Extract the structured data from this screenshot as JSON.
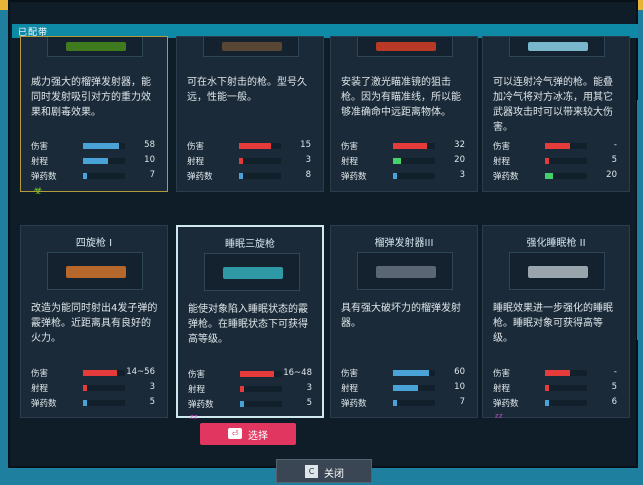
{
  "header": {
    "title": "已配带"
  },
  "stat_labels": {
    "damage": "伤害",
    "range": "射程",
    "ammo": "弹药数"
  },
  "colors": {
    "damage_bar": "#4aa3d6",
    "red_bar": "#e53b3b",
    "green_bar": "#44d36a",
    "select_button": "#e0365f"
  },
  "cards": [
    {
      "title": "",
      "description": "威力强大的榴弹发射器，能同时发射吸引对方的重力效果和剧毒效果。",
      "damage": "58",
      "range": "10",
      "ammo": "7",
      "damage_fill": 0.85,
      "range_fill": 0.6,
      "ammo_fill": 0.1,
      "status_icon": "biohazard-icon",
      "status_glyph": "☣"
    },
    {
      "title": "",
      "description": "可在水下射击的枪。型号久远，性能一般。",
      "damage": "15",
      "range": "3",
      "ammo": "8",
      "damage_fill": 0.75,
      "range_fill": 0.1,
      "ammo_fill": 0.1
    },
    {
      "title": "",
      "description": "安装了激光瞄准镜的狙击枪。因为有瞄准线，所以能够准确命中远距离物体。",
      "damage": "32",
      "range": "20",
      "ammo": "3",
      "damage_fill": 0.8,
      "range_fill": 0.2,
      "ammo_fill": 0.1
    },
    {
      "title": "",
      "description": "可以连射冷气弹的枪。能叠加冷气将对方冰冻，用其它武器攻击时可以带来较大伤害。",
      "damage": "-",
      "range": "5",
      "ammo": "20",
      "damage_fill": 0.6,
      "range_fill": 0.1,
      "ammo_fill": 0.2
    },
    {
      "title": "四旋枪 I",
      "description": "改造为能同时射出4发子弹的霰弹枪。近距离具有良好的火力。",
      "damage": "14~56",
      "range": "3",
      "ammo": "5",
      "damage_fill": 0.8,
      "range_fill": 0.1,
      "ammo_fill": 0.1
    },
    {
      "title": "睡眠三旋枪",
      "description": "能使对象陷入睡眠状态的霰弹枪。在睡眠状态下可获得高等级。",
      "damage": "16~48",
      "range": "3",
      "ammo": "5",
      "damage_fill": 0.8,
      "range_fill": 0.1,
      "ammo_fill": 0.1,
      "status_icon": "sleep-icon",
      "status_glyph": "ᶻᶻ",
      "select_label": "选择",
      "select_key": "⏎"
    },
    {
      "title": "榴弹发射器III",
      "description": "具有强大破坏力的榴弹发射器。",
      "damage": "60",
      "range": "10",
      "ammo": "7",
      "damage_fill": 0.85,
      "range_fill": 0.6,
      "ammo_fill": 0.1
    },
    {
      "title": "强化睡眠枪 II",
      "description": "睡眠效果进一步强化的睡眠枪。睡眠对象可获得高等级。",
      "damage": "-",
      "range": "5",
      "ammo": "6",
      "damage_fill": 0.6,
      "range_fill": 0.1,
      "ammo_fill": 0.1,
      "status_icon": "sleep-icon",
      "status_glyph": "ᶻᶻ"
    }
  ],
  "footer": {
    "close_key": "C",
    "close_label": "关闭"
  }
}
